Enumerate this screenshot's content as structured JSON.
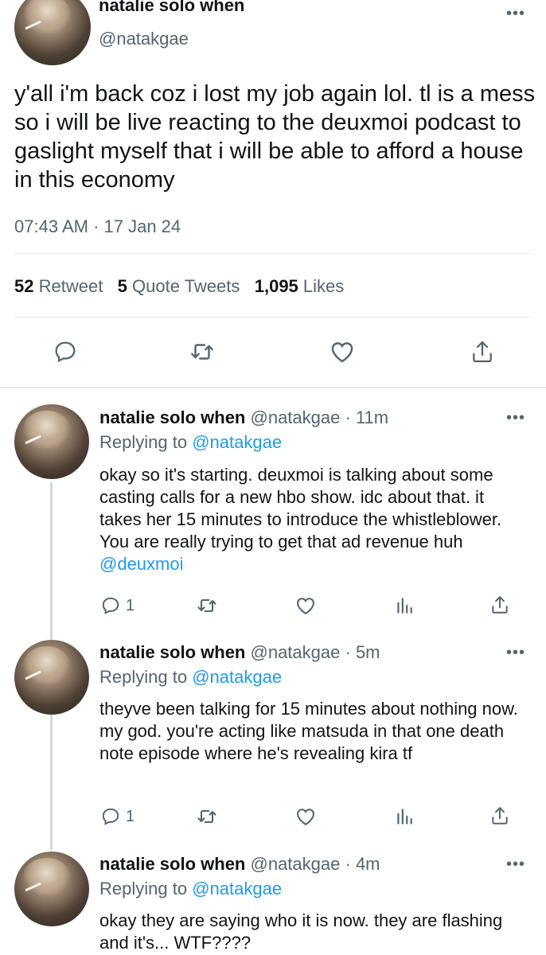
{
  "main_tweet": {
    "name": "natalie solo when",
    "handle": "@natakgae",
    "text": "y'all i'm back coz i lost my job again lol. tl is a mess so i will be live reacting to the deuxmoi podcast to gaslight myself that i will be able to afford a house in this economy",
    "time": "07:43 AM · 17 Jan 24",
    "stats": {
      "retweets": "52",
      "retweets_label": "Retweet",
      "quotes": "5",
      "quotes_label": "Quote Tweets",
      "likes": "1,095",
      "likes_label": "Likes"
    },
    "more_label": "•••"
  },
  "replies": [
    {
      "name": "natalie solo when",
      "handle": "@natakgae",
      "sep": "·",
      "time": "11m",
      "replying_prefix": "Replying to",
      "replying_handle": "@natakgae",
      "text": "okay so it's starting. deuxmoi is talking about some casting calls for a new hbo show. idc about that. it takes her 15 minutes to introduce the whistleblower. You are really trying to get that ad revenue huh",
      "mention": "@deuxmoi",
      "reply_count": "1",
      "more_label": "•••"
    },
    {
      "name": "natalie solo when",
      "handle": "@natakgae",
      "sep": "·",
      "time": "5m",
      "replying_prefix": "Replying to",
      "replying_handle": "@natakgae",
      "text": "theyve been talking for 15 minutes about nothing now. my god. you're acting like matsuda in that one death note episode where he's revealing kira tf",
      "reply_count": "1",
      "more_label": "•••"
    },
    {
      "name": "natalie solo when",
      "handle": "@natakgae",
      "sep": "·",
      "time": "4m",
      "replying_prefix": "Replying to",
      "replying_handle": "@natakgae",
      "text": "okay they are saying who it is now. they are flashing and it's... WTF????",
      "more_label": "•••"
    }
  ],
  "colors": {
    "accent": "#1d9bf0",
    "muted": "#536471",
    "divider": "#e1e8ed"
  }
}
